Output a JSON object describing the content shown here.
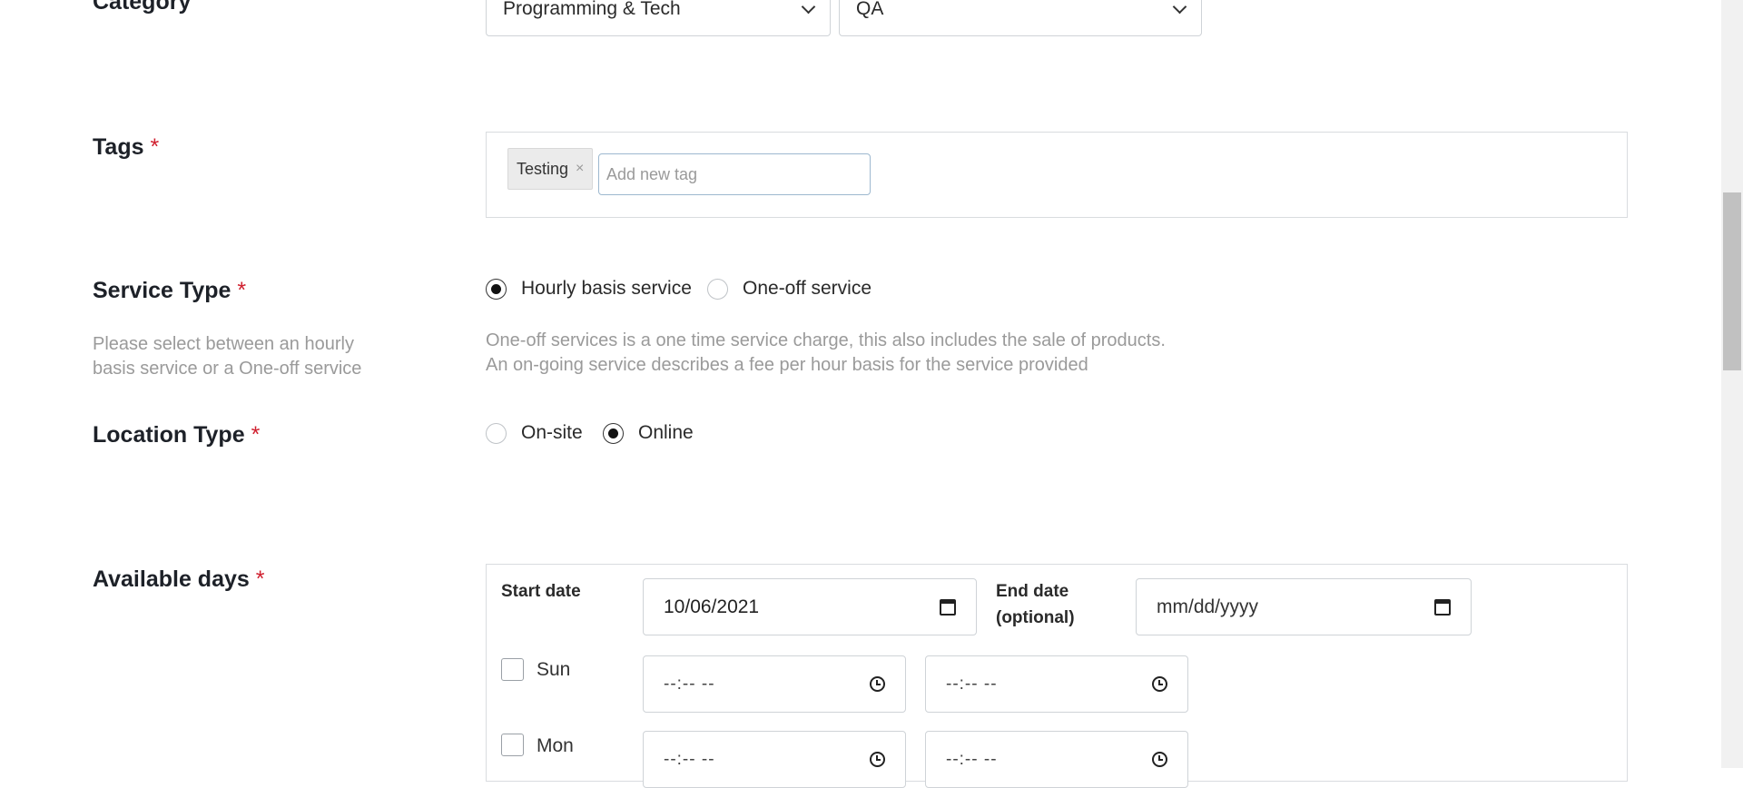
{
  "category": {
    "label": "Category",
    "main_value": "Programming & Tech",
    "sub_value": "QA"
  },
  "tags": {
    "label": "Tags",
    "required_mark": "*",
    "chips": [
      {
        "text": "Testing",
        "remove": "×"
      }
    ],
    "input_placeholder": "Add new tag"
  },
  "service_type": {
    "label": "Service Type",
    "required_mark": "*",
    "hint": "Please select between an hourly basis service or a One-off service",
    "options": [
      {
        "label": "Hourly basis service",
        "selected": true
      },
      {
        "label": "One-off service",
        "selected": false
      }
    ],
    "description_line1": "One-off services is a one time service charge, this also includes the sale of products.",
    "description_line2": "An on-going service describes a fee per hour basis for the service provided"
  },
  "location_type": {
    "label": "Location Type",
    "required_mark": "*",
    "options": [
      {
        "label": "On-site",
        "selected": false
      },
      {
        "label": "Online",
        "selected": true
      }
    ]
  },
  "available_days": {
    "label": "Available days",
    "required_mark": "*",
    "start_date_label": "Start date",
    "start_date_value": "10/06/2021",
    "end_date_label_line1": "End date",
    "end_date_label_line2": "(optional)",
    "end_date_placeholder": "mm/dd/yyyy",
    "days": [
      {
        "name": "Sun",
        "from": "--:-- --",
        "to": "--:-- --"
      },
      {
        "name": "Mon",
        "from": "--:-- --",
        "to": "--:-- --"
      }
    ]
  },
  "icons": {
    "select_chevron": "chevron-down-icon",
    "calendar": "calendar-icon",
    "clock": "clock-icon"
  }
}
